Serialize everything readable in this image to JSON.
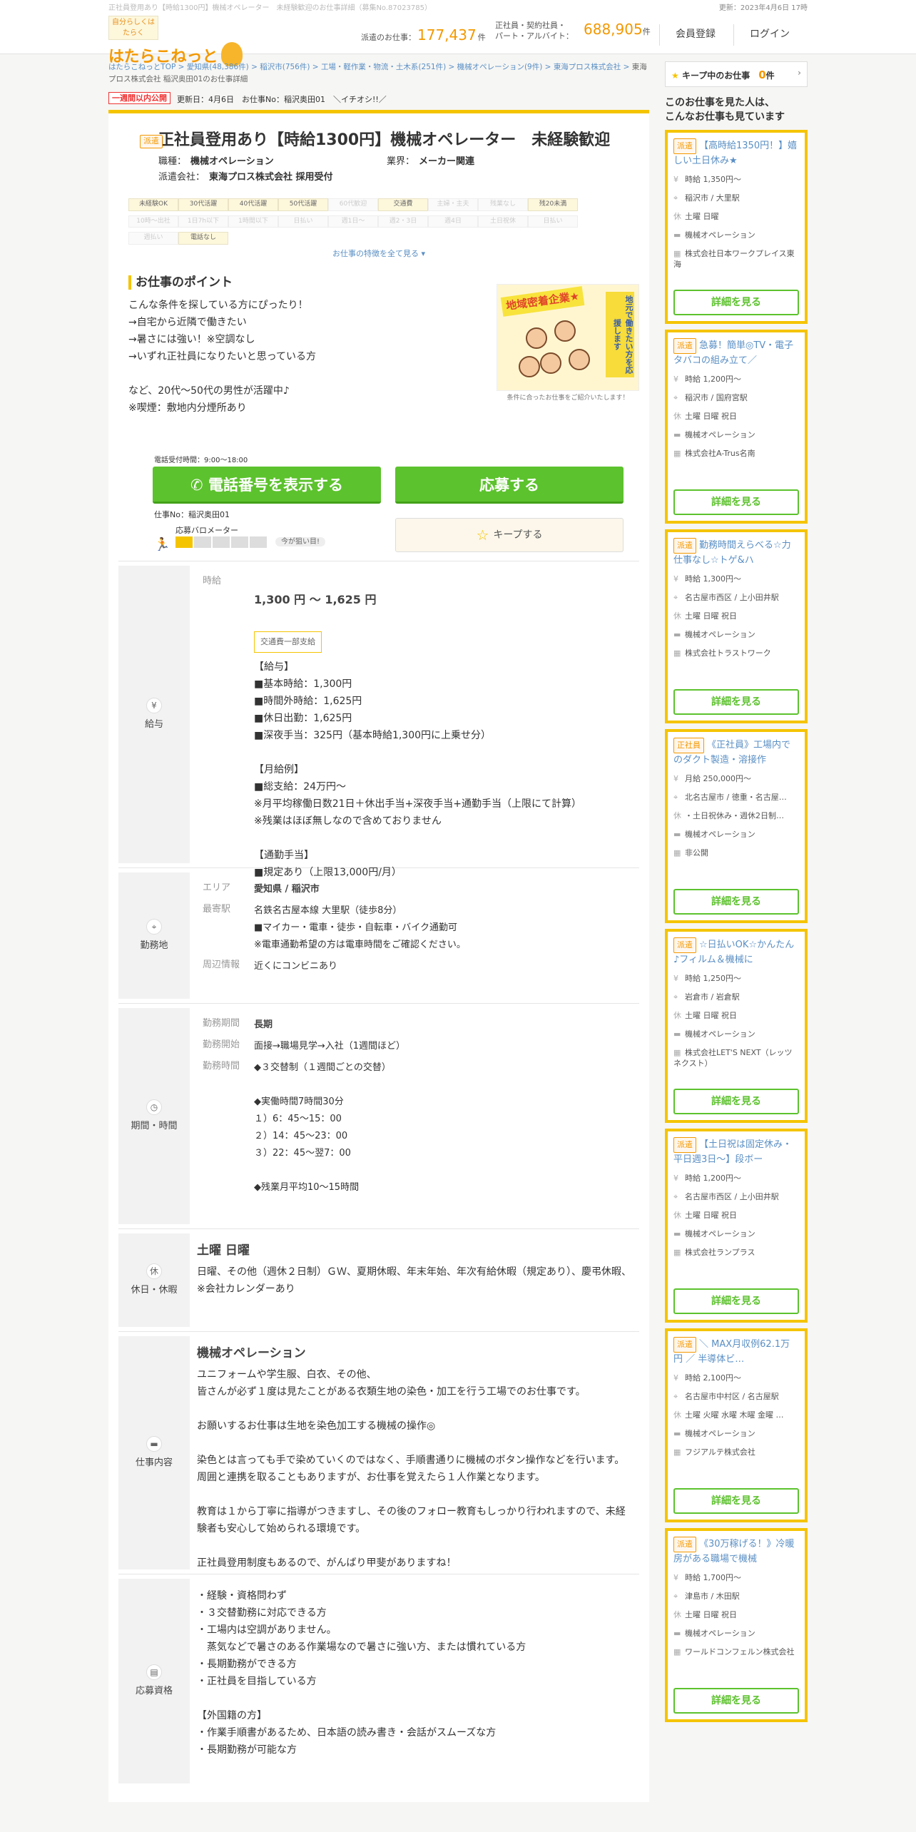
{
  "topbar": {
    "left": "正社員登用あり【時給1300円】機械オペレーター　未経験歓迎のお仕事詳細（募集No.87023785）",
    "right": "更新：2023年4月6日 17時"
  },
  "header": {
    "logo_tag": "自分らしくはたらく",
    "logo_name": "はたらこねっと",
    "stat1_label": "派遣のお仕事：",
    "stat1_value": "177,437",
    "stat1_unit": "件",
    "stat2_label": "正社員・契約社員・\nパート・アルバイト：",
    "stat2_value": "688,905",
    "stat2_unit": "件",
    "register": "会員登録",
    "login": "ログイン"
  },
  "breadcrumb": [
    "はたらこねっとTOP",
    "愛知県(48,386件)",
    "稲沢市(756件)",
    "工場・軽作業・物流・土木系(251件)",
    "機械オペレーション(9件)",
    "東海プロス株式会社",
    "東海プロス株式会社 稲沢奥田01のお仕事詳細"
  ],
  "badges": {
    "new": "一週間以内公開",
    "updated": "更新日：4月6日　お仕事No：稲沢奥田01　＼イチオシ!!／"
  },
  "job": {
    "type": "派遣",
    "title": "正社員登用あり【時給1300円】機械オペレーター　未経験歓迎",
    "occ_label": "職種：",
    "occ": "機械オペレーション",
    "ind_label": "業界：",
    "ind": "メーカー関連",
    "agency_label": "派遣会社：",
    "agency": "東海プロス株式会社 採用受付"
  },
  "tags": [
    {
      "t": "未経験OK",
      "on": true
    },
    {
      "t": "30代活躍",
      "on": true
    },
    {
      "t": "40代活躍",
      "on": true
    },
    {
      "t": "50代活躍",
      "on": true
    },
    {
      "t": "60代歓迎",
      "on": false
    },
    {
      "t": "交通費",
      "on": true
    },
    {
      "t": "主婦・主夫",
      "on": false
    },
    {
      "t": "残業なし",
      "on": false
    },
    {
      "t": "残20未満",
      "on": true
    },
    {
      "t": "10時～出社",
      "on": false
    },
    {
      "t": "1日7h以下",
      "on": false
    },
    {
      "t": "1時間以下",
      "on": false
    },
    {
      "t": "日払い",
      "on": false
    },
    {
      "t": "週1日～",
      "on": false
    },
    {
      "t": "週2・3日",
      "on": false
    },
    {
      "t": "週4日",
      "on": false
    },
    {
      "t": "土日祝休",
      "on": false
    },
    {
      "t": "日払い",
      "on": false
    },
    {
      "t": "週払い",
      "on": false
    },
    {
      "t": "電話なし",
      "on": true
    }
  ],
  "more_features": "お仕事の特徴を全て見る ▾",
  "point": {
    "title": "お仕事のポイント",
    "text": "こんな条件を探している方にぴったり！\n→自宅から近隣で働きたい\n→暑さには強い！※空調なし\n→いずれ正社員になりたいと思っている方\n\nなど、20代～50代の男性が活躍中♪\n※喫煙：敷地内分煙所あり",
    "banner": "地域密着企業★",
    "side": "地元で働きたい方を応援します",
    "caption": "条件に合ったお仕事をご紹介いたします！"
  },
  "cta": {
    "tel_hours": "電話受付時間：9:00～18:00",
    "tel": "電話番号を表示する",
    "apply": "応募する",
    "jobno": "仕事No：稲沢奥田01",
    "barometer": "応募バロメーター",
    "barometer_level": 0.2,
    "barometer_note": "今が狙い目!",
    "keep": "キープする"
  },
  "salary": {
    "label": "給与",
    "k": "時給",
    "range": "1,300 円 ～ 1,625 円",
    "pill": "交通費一部支給",
    "detail": "【給与】\n■基本時給：1,300円\n■時間外時給：1,625円\n■休日出勤：1,625円\n■深夜手当：325円（基本時給1,300円に上乗せ分）\n\n【月給例】\n■総支給：24万円～\n※月平均稼働日数21日＋休出手当+深夜手当+通勤手当（上限にて計算）\n※残業はほぼ無しなので含めておりません\n\n【通勤手当】\n■規定あり（上限13,000円/月）"
  },
  "location": {
    "label": "勤務地",
    "k1": "エリア",
    "area": "愛知県 / 稲沢市",
    "k2": "最寄駅",
    "station": "名鉄名古屋本線 大里駅（徒歩8分）\n■マイカー・電車・徒歩・自転車・バイク通勤可\n※電車通勤希望の方は電車時間をご確認ください。",
    "k3": "周辺情報",
    "around": "近くにコンビニあり"
  },
  "period": {
    "label": "期間・時間",
    "k1": "勤務期間",
    "v1": "長期",
    "k2": "勤務開始",
    "v2": "面接→職場見学→入社（1週間ほど）",
    "k3": "勤務時間",
    "v3": "◆３交替制（１週間ごとの交替）\n\n◆実働時間7時間30分\n１）6：45～15：00\n２）14：45～23：00\n３）22：45～翌7：00\n\n◆残業月平均10～15時間"
  },
  "holiday": {
    "label": "休日・休暇",
    "title": "土曜 日曜",
    "text": "日曜、その他（週休２日制）ＧＷ、夏期休暇、年末年始、年次有給休暇（規定あり）、慶弔休暇、\n※会社カレンダーあり"
  },
  "work": {
    "label": "仕事内容",
    "title": "機械オペレーション",
    "text": "ユニフォームや学生服、白衣、その他、\n皆さんが必ず１度は見たことがある衣類生地の染色・加工を行う工場でのお仕事です。\n\nお願いするお仕事は生地を染色加工する機械の操作◎\n\n染色とは言っても手で染めていくのではなく、手順書通りに機械のボタン操作などを行います。\n周囲と連携を取ることもありますが、お仕事を覚えたら１人作業となります。\n\n教育は１から丁寧に指導がつきますし、その後のフォロー教育もしっかり行われますので、未経験者も安心して始められる環境です。\n\n正社員登用制度もあるので、がんばり甲斐がありますね！"
  },
  "qual": {
    "label": "応募資格",
    "text": "・経験・資格問わず\n・３交替勤務に対応できる方\n・工場内は空調がありません。\n　蒸気などで暑さのある作業場なので暑さに強い方、または慣れている方\n・長期勤務ができる方\n・正社員を目指している方\n\n【外国籍の方】\n・作業手順書があるため、日本語の読み書き・会話がスムーズな方\n・長期勤務が可能な方"
  },
  "side": {
    "keep_label": "キープ中のお仕事",
    "keep_count": "0",
    "keep_unit": "件",
    "heading": "このお仕事を見た人は、\nこんなお仕事も見ています",
    "detail_btn": "詳細を見る",
    "jobs": [
      {
        "type": "派遣",
        "title": "【高時給1350円！】嬉しい土日休み★",
        "pay": "時給 1,350円～",
        "place": "稲沢市 / 大里駅",
        "days": "土曜 日曜",
        "occ": "機械オペレーション",
        "co": "株式会社日本ワークプレイス東海"
      },
      {
        "type": "派遣",
        "title": "急募！簡単◎TV・電子タバコの組み立て／",
        "pay": "時給 1,200円～",
        "place": "稲沢市 / 国府宮駅",
        "days": "土曜 日曜 祝日",
        "occ": "機械オペレーション",
        "co": "株式会社A-Trus名南"
      },
      {
        "type": "派遣",
        "title": "勤務時間えらべる☆力仕事なし☆トゲ&ハ",
        "pay": "時給 1,300円～",
        "place": "名古屋市西区 / 上小田井駅",
        "days": "土曜 日曜 祝日",
        "occ": "機械オペレーション",
        "co": "株式会社トラストワーク"
      },
      {
        "type": "正社員",
        "title": "《正社員》工場内でのダクト製造・溶接作",
        "pay": "月給 250,000円～",
        "place": "北名古屋市 / 徳重・名古屋…",
        "days": "・土日祝休み・週休2日制…",
        "occ": "機械オペレーション",
        "co": "非公開"
      },
      {
        "type": "派遣",
        "title": "☆日払いOK☆かんたん♪フィルム＆機械に",
        "pay": "時給 1,250円～",
        "place": "岩倉市 / 岩倉駅",
        "days": "土曜 日曜 祝日",
        "occ": "機械オペレーション",
        "co": "株式会社LET'S NEXT（レッツネクスト）"
      },
      {
        "type": "派遣",
        "title": "【土日祝は固定休み・平日週3日～】段ボー",
        "pay": "時給 1,200円～",
        "place": "名古屋市西区 / 上小田井駅",
        "days": "土曜 日曜 祝日",
        "occ": "機械オペレーション",
        "co": "株式会社ランプラス"
      },
      {
        "type": "派遣",
        "title": "＼ MAX月収例62.1万円 ／ 半導体ビ…",
        "pay": "時給 2,100円～",
        "place": "名古屋市中村区 / 名古屋駅",
        "days": "土曜 火曜 水曜 木曜 金曜 …",
        "occ": "機械オペレーション",
        "co": "フジアルテ株式会社"
      },
      {
        "type": "派遣",
        "title": "《30万稼げる！》冷暖房がある職場で機械",
        "pay": "時給 1,700円～",
        "place": "津島市 / 木田駅",
        "days": "土曜 日曜 祝日",
        "occ": "機械オペレーション",
        "co": "ワールドコンフェルン株式会社"
      }
    ]
  }
}
